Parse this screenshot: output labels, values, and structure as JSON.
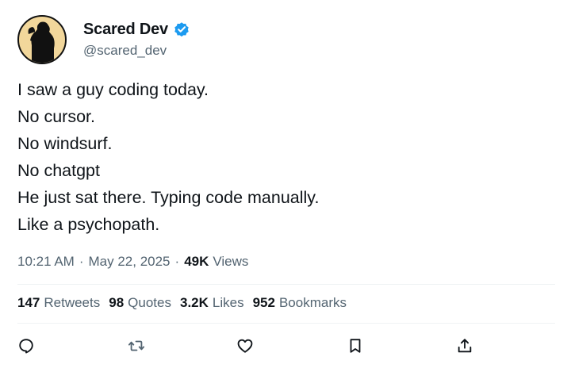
{
  "author": {
    "display_name": "Scared Dev",
    "handle": "@scared_dev",
    "verified": true,
    "avatar_icon": "silhouette-avatar-icon",
    "verified_icon": "verified-badge-icon",
    "verified_color": "#1d9bf0",
    "avatar_bg": "#f2d79b"
  },
  "tweet": {
    "lines": [
      "I saw a guy coding today.",
      "No cursor.",
      "No windsurf.",
      "No chatgpt",
      "He just sat there. Typing code manually.",
      "Like a psychopath."
    ]
  },
  "meta": {
    "time": "10:21 AM",
    "separator": "·",
    "date": "May 22, 2025",
    "views_count": "49K",
    "views_label": "Views"
  },
  "stats": {
    "retweets": {
      "count": "147",
      "label": "Retweets"
    },
    "quotes": {
      "count": "98",
      "label": "Quotes"
    },
    "likes": {
      "count": "3.2K",
      "label": "Likes"
    },
    "bookmarks": {
      "count": "952",
      "label": "Bookmarks"
    }
  },
  "actions": [
    {
      "name": "reply",
      "icon": "reply-icon"
    },
    {
      "name": "retweet",
      "icon": "retweet-icon"
    },
    {
      "name": "like",
      "icon": "heart-icon"
    },
    {
      "name": "bookmark",
      "icon": "bookmark-icon"
    },
    {
      "name": "share",
      "icon": "share-icon"
    }
  ],
  "colors": {
    "text": "#0f1419",
    "secondary": "#536471",
    "divider": "#eff3f4",
    "icon": "#536471"
  }
}
